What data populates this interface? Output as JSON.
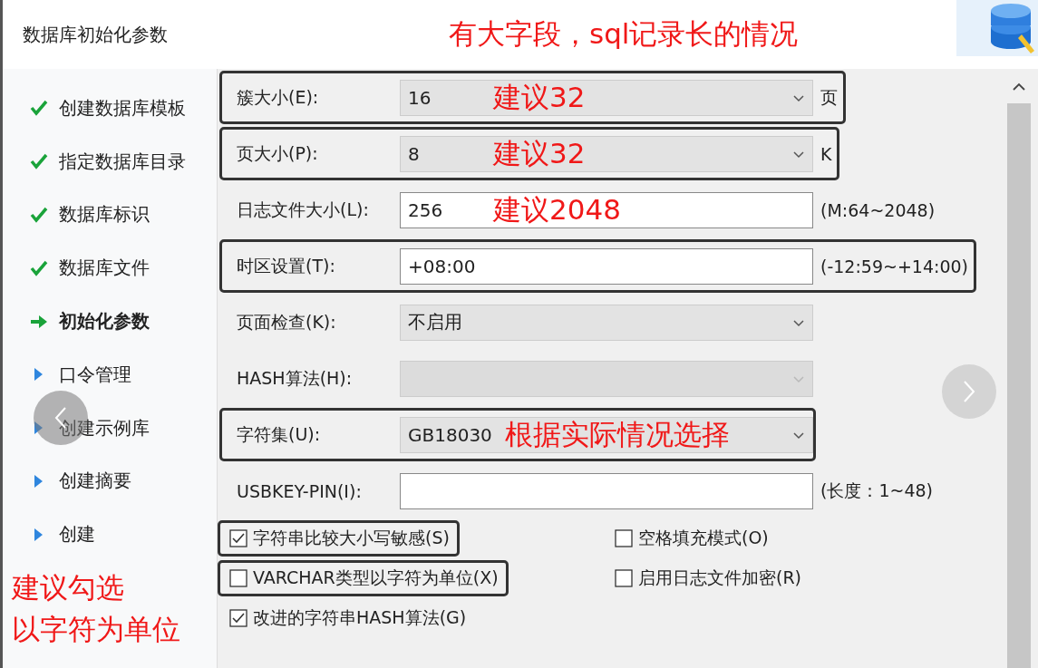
{
  "header": {
    "title": "数据库初始化参数",
    "annotation": "有大字段，sql记录长的情况"
  },
  "steps": [
    {
      "label": "创建数据库模板",
      "done": true,
      "current": false
    },
    {
      "label": "指定数据库目录",
      "done": true,
      "current": false
    },
    {
      "label": "数据库标识",
      "done": true,
      "current": false
    },
    {
      "label": "数据库文件",
      "done": true,
      "current": false
    },
    {
      "label": "初始化参数",
      "done": false,
      "current": true
    },
    {
      "label": "口令管理",
      "done": false,
      "current": false
    },
    {
      "label": "创建示例库",
      "done": false,
      "current": false
    },
    {
      "label": "创建摘要",
      "done": false,
      "current": false
    },
    {
      "label": "创建",
      "done": false,
      "current": false
    }
  ],
  "sidebar_note": [
    "建议勾选",
    "以字符为单位"
  ],
  "fields": [
    {
      "label": "簇大小(E):",
      "kind": "select",
      "value": "16",
      "unit": "页",
      "note": "建议32",
      "highlighted": true,
      "disabled": false
    },
    {
      "label": "页大小(P):",
      "kind": "select",
      "value": "8",
      "unit": "K",
      "note": "建议32",
      "highlighted": true,
      "disabled": false
    },
    {
      "label": "日志文件大小(L):",
      "kind": "input",
      "value": "256",
      "unit": "(M:64~2048)",
      "note": "建议2048",
      "highlighted": false,
      "disabled": false
    },
    {
      "label": "时区设置(T):",
      "kind": "input",
      "value": "+08:00",
      "unit": "(-12:59~+14:00)",
      "highlighted": true,
      "disabled": false
    },
    {
      "label": "页面检查(K):",
      "kind": "select",
      "value": "不启用",
      "highlighted": false,
      "disabled": false
    },
    {
      "label": "HASH算法(H):",
      "kind": "select",
      "highlighted": false,
      "disabled": true
    },
    {
      "label": "字符集(U):",
      "kind": "select",
      "value": "GB18030",
      "note": "根据实际情况选择",
      "highlighted": true,
      "disabled": false
    },
    {
      "label": "USBKEY-PIN(I):",
      "kind": "input",
      "unit": "(长度：1~48)",
      "highlighted": false,
      "disabled": false
    }
  ],
  "checkboxes": [
    {
      "label": "字符串比较大小写敏感(S)",
      "checked": true,
      "highlighted": true
    },
    {
      "label": "空格填充模式(O)",
      "checked": false,
      "highlighted": false
    },
    {
      "label": "VARCHAR类型以字符为单位(X)",
      "checked": false,
      "highlighted": true
    },
    {
      "label": "启用日志文件加密(R)",
      "checked": false,
      "highlighted": false
    },
    {
      "label": "改进的字符串HASH算法(G)",
      "checked": true,
      "highlighted": false
    }
  ]
}
